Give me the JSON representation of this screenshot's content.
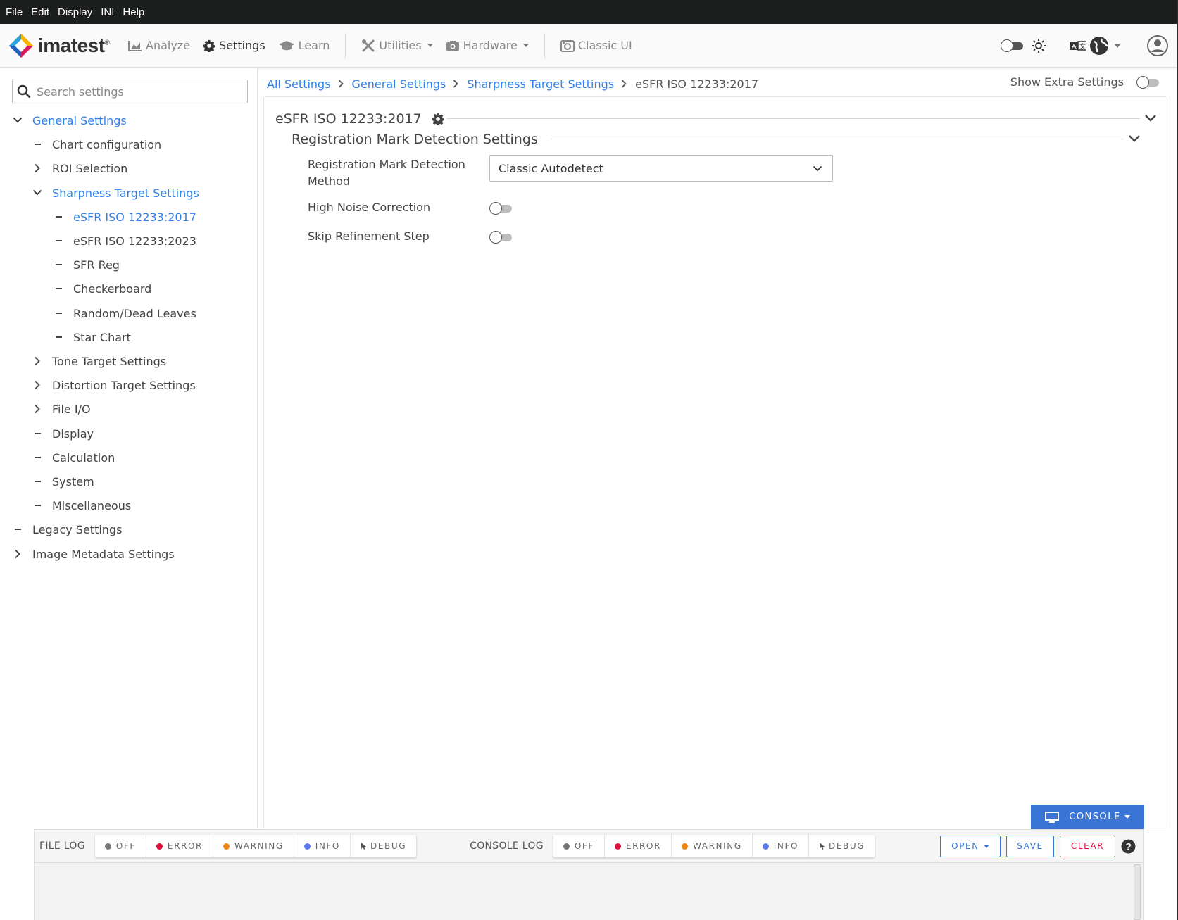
{
  "menubar": {
    "items": [
      "File",
      "Edit",
      "Display",
      "INI",
      "Help"
    ]
  },
  "appbar": {
    "brand": "imatest",
    "brand_mark": "®",
    "nav": [
      {
        "label": "Analyze",
        "icon": "chart-area-icon"
      },
      {
        "label": "Settings",
        "icon": "gear-icon"
      },
      {
        "label": "Learn",
        "icon": "graduation-cap-icon"
      },
      {
        "label": "Utilities",
        "icon": "tools-icon"
      },
      {
        "label": "Hardware",
        "icon": "camera-icon"
      },
      {
        "label": "Classic UI",
        "icon": "classic-camera-icon"
      }
    ]
  },
  "sidebar": {
    "search_placeholder": "Search settings",
    "items": [
      {
        "label": "General Settings",
        "state": "expanded",
        "level": 0,
        "link": true
      },
      {
        "label": "Chart configuration",
        "state": "leaf",
        "level": 1
      },
      {
        "label": "ROI Selection",
        "state": "collapsed",
        "level": 1
      },
      {
        "label": "Sharpness Target Settings",
        "state": "expanded",
        "level": 1,
        "link": true
      },
      {
        "label": "eSFR ISO 12233:2017",
        "state": "leaf",
        "level": 2,
        "link": true
      },
      {
        "label": "eSFR ISO 12233:2023",
        "state": "leaf",
        "level": 2
      },
      {
        "label": "SFR Reg",
        "state": "leaf",
        "level": 2
      },
      {
        "label": "Checkerboard",
        "state": "leaf",
        "level": 2
      },
      {
        "label": "Random/Dead Leaves",
        "state": "leaf",
        "level": 2
      },
      {
        "label": "Star Chart",
        "state": "leaf",
        "level": 2
      },
      {
        "label": "Tone Target Settings",
        "state": "collapsed",
        "level": 1
      },
      {
        "label": "Distortion Target Settings",
        "state": "collapsed",
        "level": 1
      },
      {
        "label": "File I/O",
        "state": "collapsed",
        "level": 1
      },
      {
        "label": "Display",
        "state": "leaf",
        "level": 1
      },
      {
        "label": "Calculation",
        "state": "leaf",
        "level": 1
      },
      {
        "label": "System",
        "state": "leaf",
        "level": 1
      },
      {
        "label": "Miscellaneous",
        "state": "leaf",
        "level": 1
      },
      {
        "label": "Legacy Settings",
        "state": "leaf",
        "level": 0
      },
      {
        "label": "Image Metadata Settings",
        "state": "collapsed",
        "level": 0
      }
    ]
  },
  "breadcrumb": [
    "All Settings",
    "General Settings",
    "Sharpness Target Settings",
    "eSFR ISO 12233:2017"
  ],
  "show_extra_label": "Show Extra Settings",
  "section": {
    "title": "eSFR ISO 12233:2017",
    "subsection_title": "Registration Mark Detection Settings",
    "fields": {
      "method_label_line1": "Registration Mark Detection",
      "method_label_line2": "Method",
      "method_value": "Classic Autodetect",
      "noise_label": "High Noise Correction",
      "skip_label": "Skip Refinement Step"
    }
  },
  "console": {
    "button_label": "CONSOLE",
    "file_log_label": "FILE LOG",
    "console_log_label": "CONSOLE LOG",
    "levels": [
      {
        "label": "OFF",
        "color": "#777777"
      },
      {
        "label": "ERROR",
        "color": "#e0103d"
      },
      {
        "label": "WARNING",
        "color": "#f0850f"
      },
      {
        "label": "INFO",
        "color": "#5b78f0"
      },
      {
        "label": "DEBUG",
        "color": "#555555"
      }
    ],
    "open_label": "OPEN",
    "save_label": "SAVE",
    "clear_label": "CLEAR"
  },
  "colors": {
    "accent": "#2f80ed",
    "console_blue": "#3a75d6",
    "clear_red": "#e0103d",
    "menubar": "#1c1e1d"
  }
}
